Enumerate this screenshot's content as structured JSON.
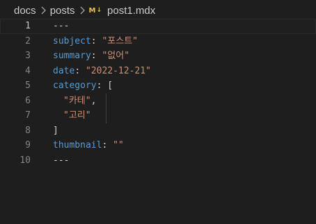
{
  "breadcrumb": {
    "items": [
      "docs",
      "posts"
    ],
    "file_icon_text": "M",
    "file_icon_arrow": "↓",
    "file_name": "post1.mdx"
  },
  "editor": {
    "lines": [
      {
        "number": "1",
        "parts": [
          {
            "t": "---",
            "c": "punc"
          }
        ]
      },
      {
        "number": "2",
        "parts": [
          {
            "t": "subject",
            "c": "key"
          },
          {
            "t": ": ",
            "c": "punc"
          },
          {
            "t": "\"포스트\"",
            "c": "str"
          }
        ]
      },
      {
        "number": "3",
        "parts": [
          {
            "t": "summary",
            "c": "key"
          },
          {
            "t": ": ",
            "c": "punc"
          },
          {
            "t": "\"없어\"",
            "c": "str"
          }
        ]
      },
      {
        "number": "4",
        "parts": [
          {
            "t": "date",
            "c": "key"
          },
          {
            "t": ": ",
            "c": "punc"
          },
          {
            "t": "\"2022-12-21\"",
            "c": "str"
          }
        ]
      },
      {
        "number": "5",
        "parts": [
          {
            "t": "category",
            "c": "key"
          },
          {
            "t": ": [",
            "c": "punc"
          }
        ]
      },
      {
        "number": "6",
        "indent": true,
        "parts": [
          {
            "t": "\"카테\"",
            "c": "str"
          },
          {
            "t": ",",
            "c": "punc"
          }
        ]
      },
      {
        "number": "7",
        "indent": true,
        "parts": [
          {
            "t": "\"고리\"",
            "c": "str"
          }
        ]
      },
      {
        "number": "8",
        "parts": [
          {
            "t": "]",
            "c": "punc"
          }
        ]
      },
      {
        "number": "9",
        "parts": [
          {
            "t": "thumbnail",
            "c": "key"
          },
          {
            "t": ": ",
            "c": "punc"
          },
          {
            "t": "\"\"",
            "c": "str"
          }
        ]
      },
      {
        "number": "10",
        "parts": [
          {
            "t": "---",
            "c": "punc"
          }
        ]
      }
    ],
    "current_line": "1"
  }
}
